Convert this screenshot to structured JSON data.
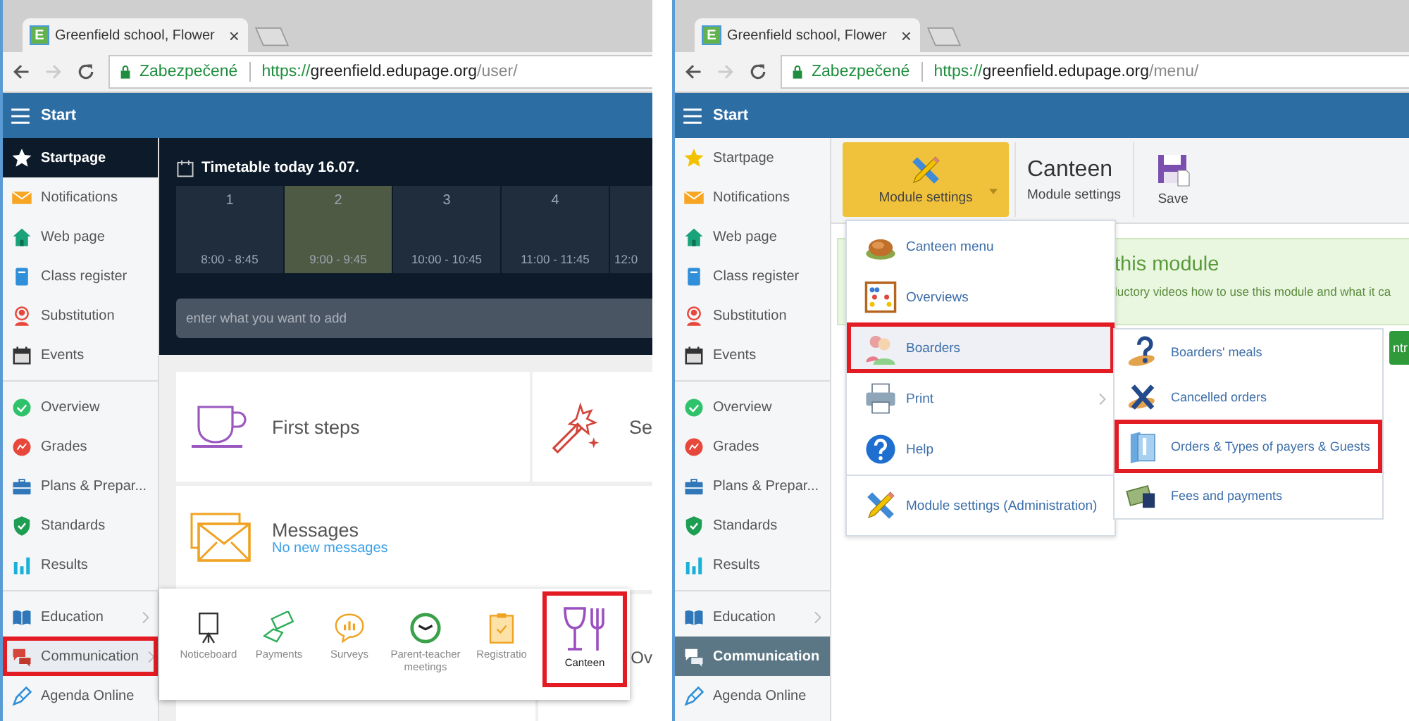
{
  "panels": [
    {
      "browser": {
        "favicon": "E",
        "tab_title": "Greenfield school, Flower",
        "tab_close": "×",
        "security": "Zabezpečené",
        "url_scheme": "https://",
        "url_host": "greenfield.edupage.org",
        "url_path": "/user/"
      },
      "header": {
        "title": "Start"
      },
      "sidebar": {
        "sections": [
          [
            {
              "label": "Startpage",
              "selected": true,
              "highlighted": false,
              "submenu": false
            },
            {
              "label": "Notifications",
              "selected": false,
              "highlighted": false,
              "submenu": false
            },
            {
              "label": "Web page",
              "selected": false,
              "highlighted": false,
              "submenu": false
            },
            {
              "label": "Class register",
              "selected": false,
              "highlighted": false,
              "submenu": false
            },
            {
              "label": "Substitution",
              "selected": false,
              "highlighted": false,
              "submenu": false
            },
            {
              "label": "Events",
              "selected": false,
              "highlighted": false,
              "submenu": false
            }
          ],
          [
            {
              "label": "Overview",
              "selected": false,
              "highlighted": false,
              "submenu": false
            },
            {
              "label": "Grades",
              "selected": false,
              "highlighted": false,
              "submenu": false
            },
            {
              "label": "Plans & Prepar...",
              "selected": false,
              "highlighted": false,
              "submenu": false
            },
            {
              "label": "Standards",
              "selected": false,
              "highlighted": false,
              "submenu": false
            },
            {
              "label": "Results",
              "selected": false,
              "highlighted": false,
              "submenu": false
            }
          ],
          [
            {
              "label": "Education",
              "selected": false,
              "highlighted": false,
              "submenu": true
            },
            {
              "label": "Communication",
              "selected": false,
              "highlighted": true,
              "submenu": true
            },
            {
              "label": "Agenda Online",
              "selected": false,
              "highlighted": false,
              "submenu": false
            }
          ]
        ]
      },
      "main": {
        "kind": "dashboard",
        "timetable": {
          "title": "Timetable today 16.07.",
          "lessons": [
            {
              "number": "1",
              "time": "8:00 - 8:45",
              "selected": false
            },
            {
              "number": "2",
              "time": "9:00 - 9:45",
              "selected": true
            },
            {
              "number": "3",
              "time": "10:00 - 10:45",
              "selected": false
            },
            {
              "number": "4",
              "time": "11:00 - 11:45",
              "selected": false
            },
            {
              "time": "12:0",
              "selected": false
            }
          ]
        },
        "add_field": {
          "placeholder": "enter what you want to add"
        },
        "cards": [
          {
            "title": "First steps"
          },
          {
            "title": "Se"
          }
        ],
        "messages": {
          "title": "Messages",
          "status": "No new messages"
        },
        "covered_card": {
          "title": "Ov"
        },
        "apps_popup": {
          "apps": [
            {
              "label": "Noticeboard",
              "highlighted": false
            },
            {
              "label": "Payments",
              "highlighted": false
            },
            {
              "label": "Surveys",
              "highlighted": false
            },
            {
              "label": "Parent-teacher meetings",
              "highlighted": false
            },
            {
              "label": "Registratio",
              "highlighted": false
            },
            {
              "label": "Canteen",
              "highlighted": true
            }
          ]
        }
      }
    },
    {
      "browser": {
        "favicon": "E",
        "tab_title": "Greenfield school, Flower",
        "tab_close": "×",
        "security": "Zabezpečené",
        "url_scheme": "https://",
        "url_host": "greenfield.edupage.org",
        "url_path": "/menu/"
      },
      "header": {
        "title": "Start"
      },
      "sidebar": {
        "sections": [
          [
            {
              "label": "Startpage",
              "selected": false,
              "highlighted": false,
              "submenu": false
            },
            {
              "label": "Notifications",
              "selected": false,
              "highlighted": false,
              "submenu": false
            },
            {
              "label": "Web page",
              "selected": false,
              "highlighted": false,
              "submenu": false
            },
            {
              "label": "Class register",
              "selected": false,
              "highlighted": false,
              "submenu": false
            },
            {
              "label": "Substitution",
              "selected": false,
              "highlighted": false,
              "submenu": false
            },
            {
              "label": "Events",
              "selected": false,
              "highlighted": false,
              "submenu": false
            }
          ],
          [
            {
              "label": "Overview",
              "selected": false,
              "highlighted": false,
              "submenu": false
            },
            {
              "label": "Grades",
              "selected": false,
              "highlighted": false,
              "submenu": false
            },
            {
              "label": "Plans & Prepar...",
              "selected": false,
              "highlighted": false,
              "submenu": false
            },
            {
              "label": "Standards",
              "selected": false,
              "highlighted": false,
              "submenu": false
            },
            {
              "label": "Results",
              "selected": false,
              "highlighted": false,
              "submenu": false
            }
          ],
          [
            {
              "label": "Education",
              "selected": false,
              "highlighted": false,
              "submenu": true
            },
            {
              "label": "Communication",
              "selected": true,
              "highlighted": false,
              "submenu": true
            },
            {
              "label": "Agenda Online",
              "selected": false,
              "highlighted": false,
              "submenu": false
            }
          ]
        ]
      },
      "main": {
        "kind": "module",
        "toolbar": {
          "settings_button": "Module settings",
          "title": "Canteen",
          "subtitle": "Module settings",
          "save": "Save"
        },
        "info": {
          "title": "this module",
          "text": "luctory videos how to use this module and what it ca",
          "button": "ntr"
        },
        "menu": {
          "sections": [
            [
              {
                "label": "Canteen menu",
                "selected": false,
                "highlighted": false,
                "submenu": false
              },
              {
                "label": "Overviews",
                "selected": false,
                "highlighted": false,
                "submenu": false
              },
              {
                "label": "Boarders",
                "selected": true,
                "highlighted": true,
                "submenu": false
              },
              {
                "label": "Print",
                "selected": false,
                "highlighted": false,
                "submenu": true
              },
              {
                "label": "Help",
                "selected": false,
                "highlighted": false,
                "submenu": false
              }
            ],
            [
              {
                "label": "Module settings (Administration)",
                "selected": false,
                "highlighted": false,
                "submenu": false
              }
            ]
          ]
        },
        "submenu": {
          "items": [
            {
              "label": "Boarders' meals",
              "highlighted": false
            },
            {
              "label": "Cancelled orders",
              "highlighted": false
            },
            {
              "label": "Orders & Types of payers & Guests",
              "highlighted": true
            },
            {
              "label": "Fees and payments",
              "highlighted": false
            }
          ]
        }
      }
    }
  ]
}
